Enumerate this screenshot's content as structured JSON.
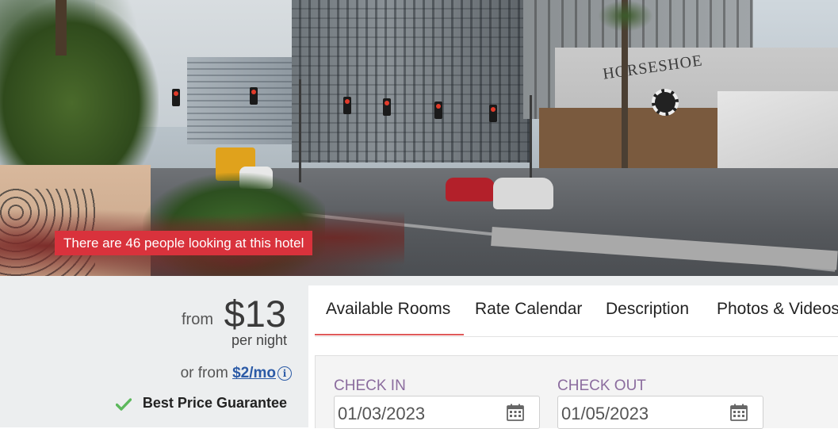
{
  "hero": {
    "sign_text": "HORSESHOE",
    "live_badge": "There are 46 people looking at this hotel",
    "badge_color": "#d9323c"
  },
  "pricing": {
    "from_label": "from",
    "price": "$13",
    "per_night": "per night",
    "monthly_prefix": "or from",
    "monthly_price": "$2/mo",
    "info_symbol": "i",
    "guarantee": "Best Price Guarantee",
    "check_color": "#5cb85c"
  },
  "tabs": [
    {
      "label": "Available Rooms",
      "active": true
    },
    {
      "label": "Rate Calendar",
      "active": false
    },
    {
      "label": "Description",
      "active": false
    },
    {
      "label": "Photos & Videos",
      "active": false
    }
  ],
  "booking": {
    "check_in_label": "CHECK IN",
    "check_in_value": "01/03/2023",
    "check_out_label": "CHECK OUT",
    "check_out_value": "01/05/2023",
    "icon": "calendar-icon"
  },
  "colors": {
    "accent": "#e05a5a",
    "link": "#2b5aa6",
    "label": "#8b6c9e"
  }
}
